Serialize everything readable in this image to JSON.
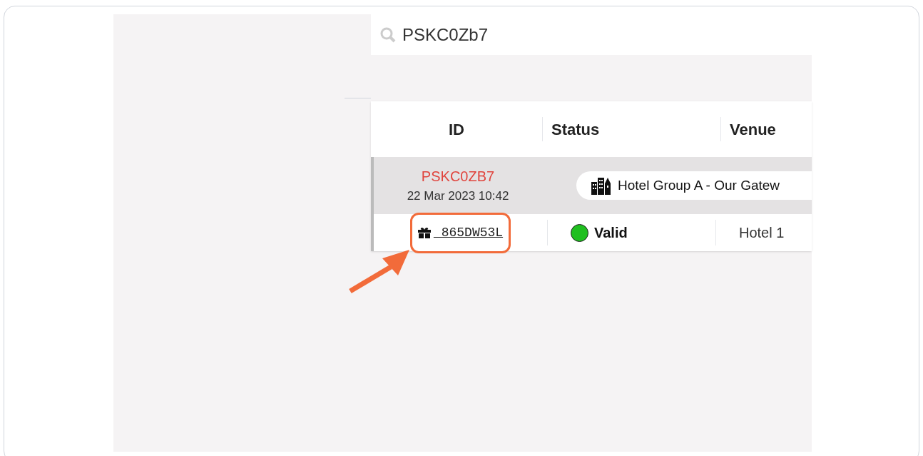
{
  "search": {
    "value": "PSKC0Zb7"
  },
  "table": {
    "columns": [
      "ID",
      "Status",
      "Venue"
    ],
    "groups": [
      {
        "id": "PSKC0ZB7",
        "date": "22 Mar 2023 10:42",
        "venue": "Hotel Group A - Our Gatew",
        "rows": [
          {
            "code": "_865DW53L",
            "highlighted": true,
            "status": "Valid",
            "color": "#1fbf1f",
            "venue": "Hotel 1"
          }
        ]
      }
    ]
  }
}
